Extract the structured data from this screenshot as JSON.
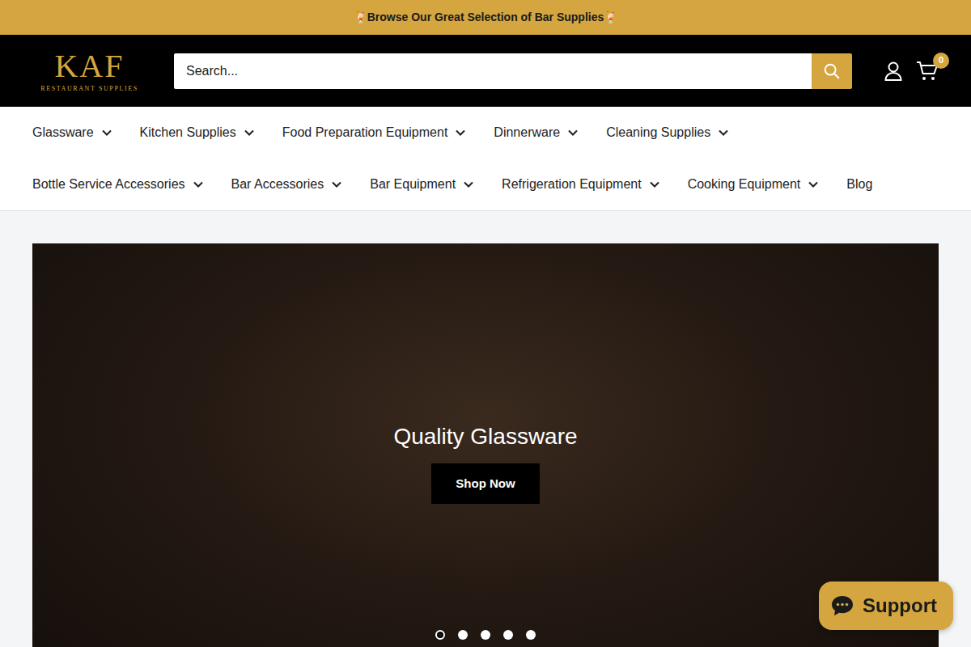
{
  "announcement": {
    "text": "🍹Browse Our Great Selection of Bar Supplies🍹"
  },
  "header": {
    "logo": {
      "mark": "KAF",
      "tagline": "RESTAURANT SUPPLIES"
    },
    "search": {
      "placeholder": "Search..."
    },
    "cart": {
      "count": "0"
    }
  },
  "nav": {
    "rows": [
      {
        "items": [
          {
            "label": "Glassware",
            "has_menu": true
          },
          {
            "label": "Kitchen Supplies",
            "has_menu": true
          },
          {
            "label": "Food Preparation Equipment",
            "has_menu": true
          },
          {
            "label": "Dinnerware",
            "has_menu": true
          },
          {
            "label": "Cleaning Supplies",
            "has_menu": true
          }
        ]
      },
      {
        "items": [
          {
            "label": "Bottle Service Accessories",
            "has_menu": true
          },
          {
            "label": "Bar Accessories",
            "has_menu": true
          },
          {
            "label": "Bar Equipment",
            "has_menu": true
          },
          {
            "label": "Refrigeration Equipment",
            "has_menu": true
          },
          {
            "label": "Cooking Equipment",
            "has_menu": true
          },
          {
            "label": "Blog",
            "has_menu": false
          }
        ]
      }
    ]
  },
  "hero": {
    "title": "Quality Glassware",
    "button": "Shop Now",
    "dots": [
      {
        "selected": true
      },
      {
        "selected": false
      },
      {
        "selected": false
      },
      {
        "selected": false
      },
      {
        "selected": false
      }
    ]
  },
  "support": {
    "label": "Support"
  }
}
